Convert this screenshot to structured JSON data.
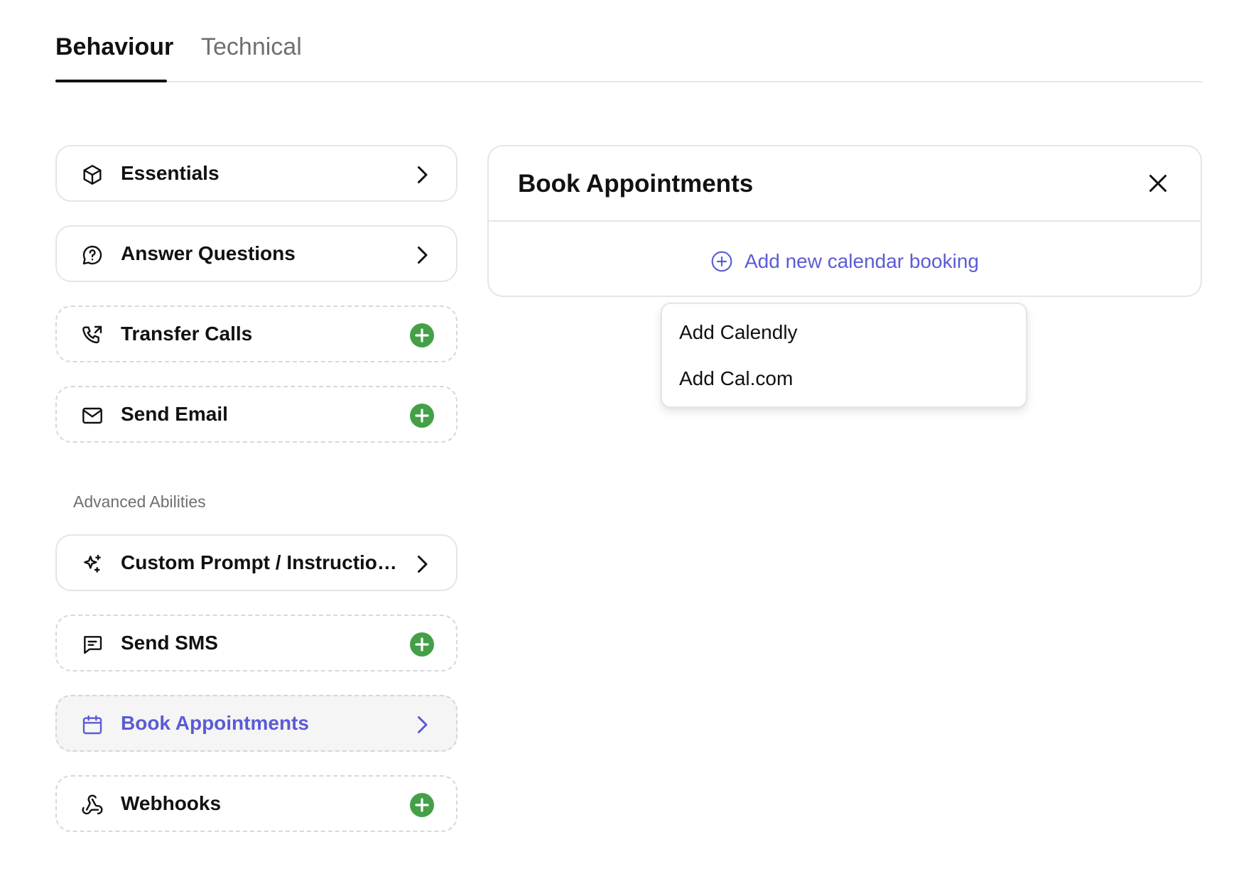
{
  "tabs": [
    {
      "label": "Behaviour",
      "active": true
    },
    {
      "label": "Technical",
      "active": false
    }
  ],
  "abilities": [
    {
      "label": "Essentials",
      "icon": "box-icon",
      "action": "chevron-right-icon"
    },
    {
      "label": "Answer Questions",
      "icon": "chat-question-icon",
      "action": "chevron-right-icon"
    },
    {
      "label": "Transfer Calls",
      "icon": "phone-forward-icon",
      "action": "plus-circle-icon"
    },
    {
      "label": "Send Email",
      "icon": "mail-icon",
      "action": "plus-circle-icon"
    }
  ],
  "advanced": {
    "heading": "Advanced Abilities",
    "items": [
      {
        "label": "Custom Prompt / Instructions",
        "icon": "sparkles-icon",
        "action": "chevron-right-icon"
      },
      {
        "label": "Send SMS",
        "icon": "message-square-icon",
        "action": "plus-circle-icon"
      },
      {
        "label": "Book Appointments",
        "icon": "calendar-icon",
        "action": "chevron-right-icon",
        "selected": true
      },
      {
        "label": "Webhooks",
        "icon": "webhook-icon",
        "action": "plus-circle-icon"
      }
    ]
  },
  "panel": {
    "title": "Book Appointments",
    "add_label": "Add new calendar booking"
  },
  "dropdown": {
    "items": [
      "Add Calendly",
      "Add Cal.com"
    ]
  },
  "colors": {
    "accent": "#5b5bd6",
    "add_green": "#43a047",
    "text": "#111111",
    "muted": "#6f6f6f",
    "border": "#e5e5e5"
  }
}
